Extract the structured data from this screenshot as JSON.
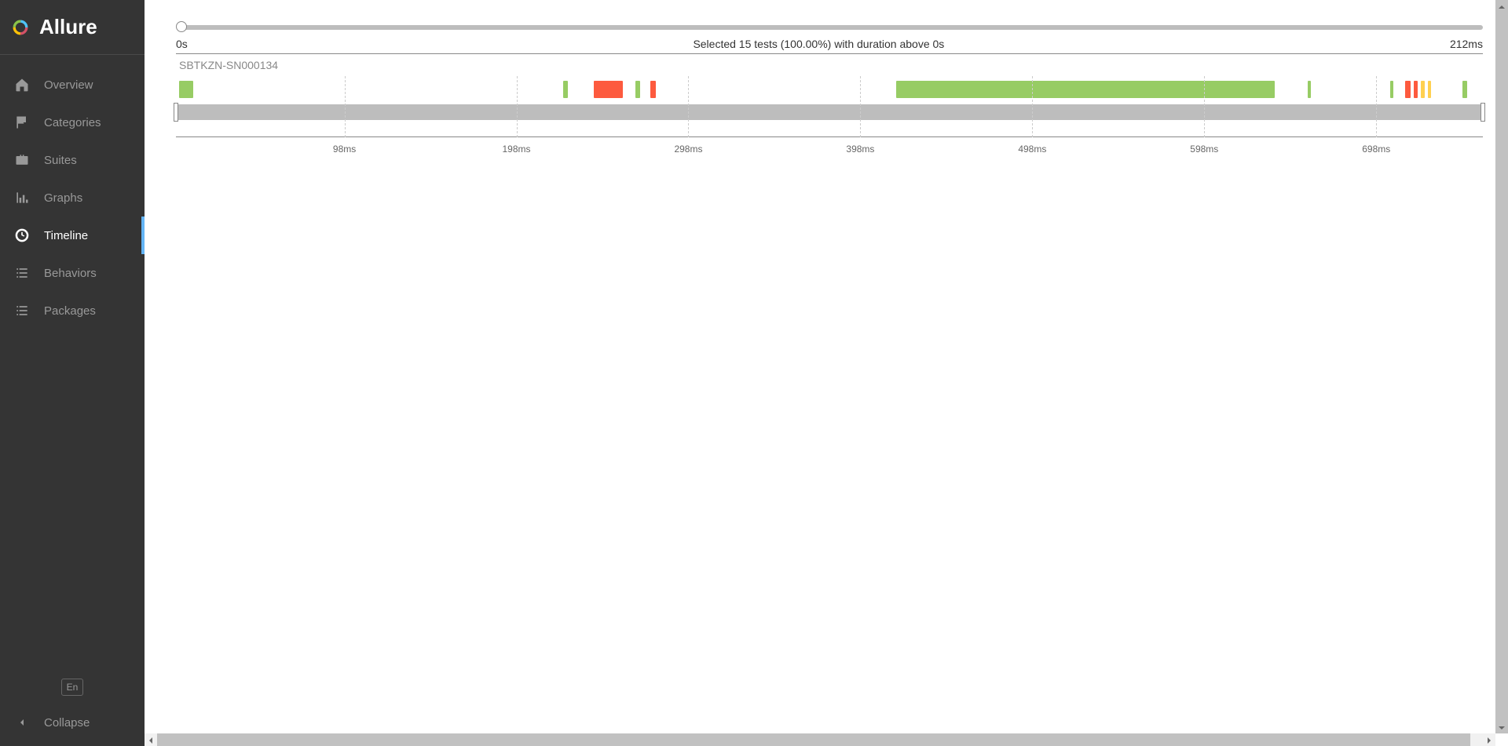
{
  "brand": {
    "name": "Allure"
  },
  "sidebar": {
    "items": [
      {
        "id": "overview",
        "label": "Overview",
        "icon": "home-icon"
      },
      {
        "id": "categories",
        "label": "Categories",
        "icon": "flag-icon"
      },
      {
        "id": "suites",
        "label": "Suites",
        "icon": "briefcase-icon"
      },
      {
        "id": "graphs",
        "label": "Graphs",
        "icon": "bar-chart-icon"
      },
      {
        "id": "timeline",
        "label": "Timeline",
        "icon": "clock-icon",
        "active": true
      },
      {
        "id": "behaviors",
        "label": "Behaviors",
        "icon": "list-icon"
      },
      {
        "id": "packages",
        "label": "Packages",
        "icon": "list-icon"
      }
    ],
    "language_label": "En",
    "collapse_label": "Collapse"
  },
  "timeline": {
    "selection_label": "Selected 15 tests (100.00%) with duration above 0s",
    "range_start_label": "0s",
    "range_end_label": "212ms",
    "host": "SBTKZN-SN000134",
    "axis_max_ms": 760,
    "ticks": [
      {
        "value": 98,
        "label": "98ms"
      },
      {
        "value": 198,
        "label": "198ms"
      },
      {
        "value": 298,
        "label": "298ms"
      },
      {
        "value": 398,
        "label": "398ms"
      },
      {
        "value": 498,
        "label": "498ms"
      },
      {
        "value": 598,
        "label": "598ms"
      },
      {
        "value": 698,
        "label": "698ms"
      }
    ],
    "bars": [
      {
        "start": 2,
        "end": 10,
        "status": "passed"
      },
      {
        "start": 225,
        "end": 228,
        "status": "passed"
      },
      {
        "start": 243,
        "end": 260,
        "status": "failed"
      },
      {
        "start": 267,
        "end": 270,
        "status": "passed"
      },
      {
        "start": 276,
        "end": 279,
        "status": "failed"
      },
      {
        "start": 419,
        "end": 639,
        "status": "passed"
      },
      {
        "start": 658,
        "end": 660,
        "status": "passed"
      },
      {
        "start": 706,
        "end": 708,
        "status": "passed"
      },
      {
        "start": 715,
        "end": 718,
        "status": "failed"
      },
      {
        "start": 720,
        "end": 722,
        "status": "failed"
      },
      {
        "start": 724,
        "end": 726,
        "status": "broken"
      },
      {
        "start": 728,
        "end": 730,
        "status": "broken"
      },
      {
        "start": 748,
        "end": 751,
        "status": "passed"
      }
    ]
  },
  "colors": {
    "passed": "#97cc64",
    "failed": "#fd5a3e",
    "broken": "#ffd050"
  }
}
